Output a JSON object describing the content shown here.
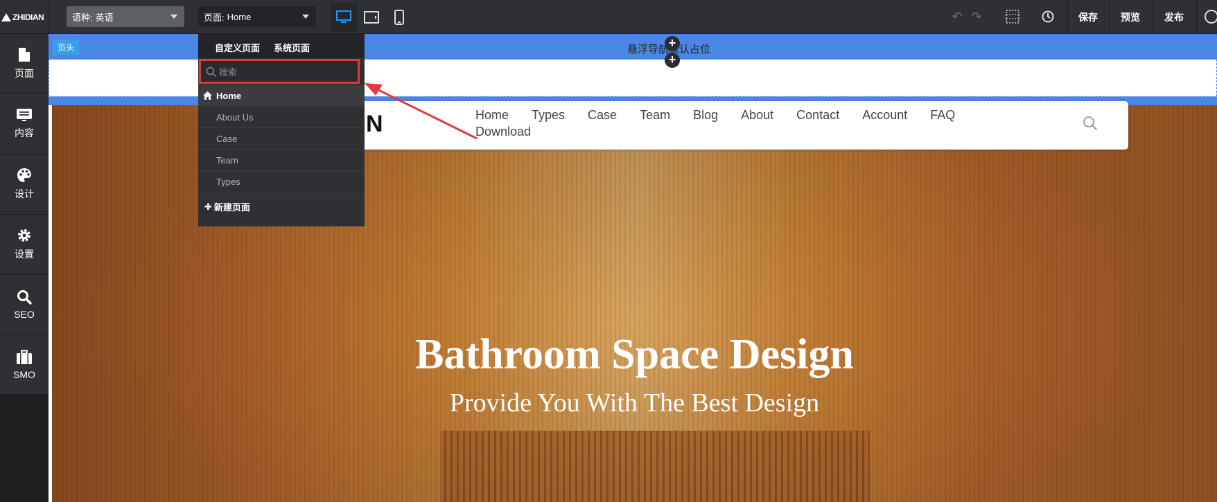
{
  "topbar": {
    "logo_text": "ZHIDIAN",
    "language_select": {
      "label": "语种:",
      "value": "英语"
    },
    "page_select": {
      "label": "页面:",
      "value": "Home"
    },
    "devices": [
      "desktop-icon",
      "tablet-icon",
      "mobile-icon"
    ],
    "active_device": "desktop",
    "actions": {
      "save": "保存",
      "preview": "预览",
      "publish": "发布"
    },
    "accent_color": "#1b9cf0"
  },
  "sidebar": {
    "items": [
      {
        "label": "页面",
        "icon": "page-icon"
      },
      {
        "label": "内容",
        "icon": "content-icon"
      },
      {
        "label": "设计",
        "icon": "palette-icon"
      },
      {
        "label": "设置",
        "icon": "gear-icon"
      },
      {
        "label": "SEO",
        "icon": "search-icon"
      },
      {
        "label": "SMO",
        "icon": "briefcase-icon"
      }
    ]
  },
  "page_dropdown": {
    "tabs": [
      "自定义页面",
      "系统页面"
    ],
    "search_placeholder": "搜索",
    "home_label": "Home",
    "pages": [
      "About Us",
      "Case",
      "Team",
      "Types"
    ],
    "new_page": "新建页面",
    "highlight_color": "#e03b3b"
  },
  "canvas": {
    "header_tag": "页头",
    "placeholder_text": "悬浮导航默认占位",
    "site_logo_text": "N",
    "nav_links": [
      "Home",
      "Types",
      "Case",
      "Team",
      "Blog",
      "About",
      "Contact",
      "Account",
      "FAQ",
      "Download"
    ],
    "hero_title": "Bathroom Space Design",
    "hero_subtitle": "Provide You With The Best Design",
    "header_color": "#4a86e4"
  }
}
